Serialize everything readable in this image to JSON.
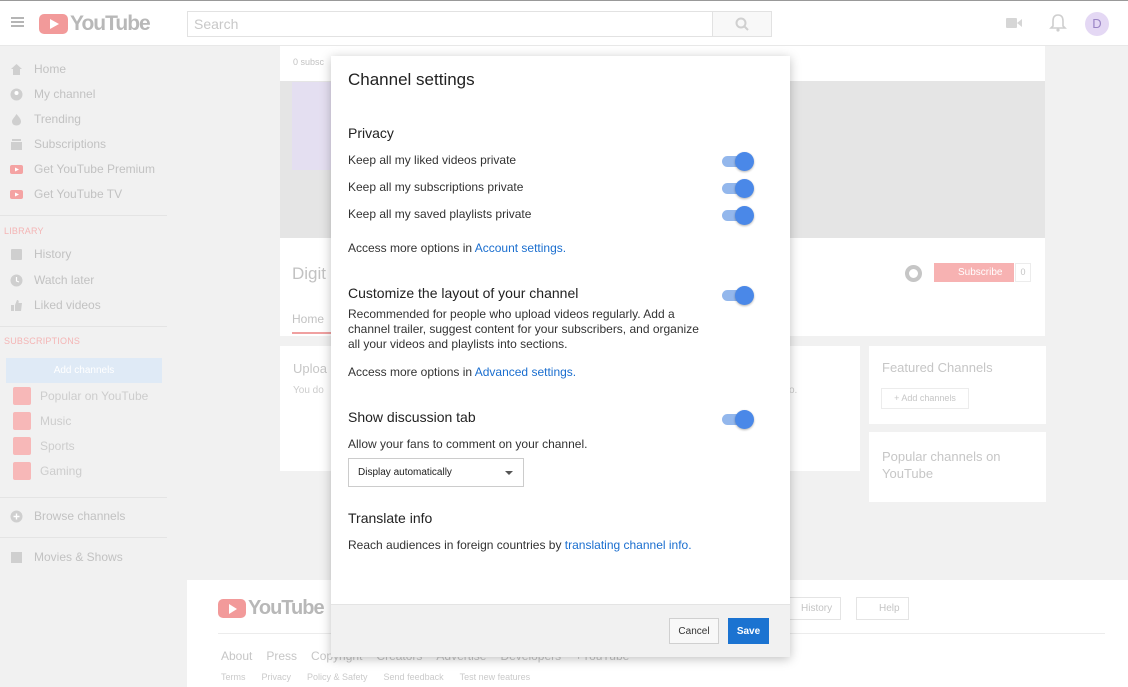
{
  "header": {
    "logo_text": "YouTube",
    "search_placeholder": "Search",
    "avatar_letter": "D"
  },
  "sidebar": {
    "items": [
      {
        "label": "Home",
        "icon": "home-icon"
      },
      {
        "label": "My channel",
        "icon": "person-icon"
      },
      {
        "label": "Trending",
        "icon": "flame-icon"
      },
      {
        "label": "Subscriptions",
        "icon": "subscriptions-icon"
      },
      {
        "label": "Get YouTube Premium",
        "icon": "youtube-icon"
      },
      {
        "label": "Get YouTube TV",
        "icon": "youtube-tv-icon"
      }
    ],
    "library_title": "LIBRARY",
    "library": [
      {
        "label": "History",
        "icon": "history-icon"
      },
      {
        "label": "Watch later",
        "icon": "clock-icon"
      },
      {
        "label": "Liked videos",
        "icon": "thumbs-up-icon"
      }
    ],
    "subscriptions_title": "SUBSCRIPTIONS",
    "add_channels": "Add channels",
    "subscriptions": [
      {
        "label": "Popular on YouTube"
      },
      {
        "label": "Music"
      },
      {
        "label": "Sports"
      },
      {
        "label": "Gaming"
      }
    ],
    "browse_channels": "Browse channels",
    "movies_shows": "Movies & Shows"
  },
  "channel": {
    "subscriber_strip": "0 subsc",
    "name": "Digit",
    "tab_home": "Home",
    "subscribe": "Subscribe",
    "subscriber_count": "0",
    "upload_title": "Uploa",
    "upload_text": "You do",
    "upload_tail": "o.",
    "featured_title": "Featured Channels",
    "featured_add": "+ Add channels",
    "popular_title": "Popular channels on YouTube"
  },
  "footer": {
    "logo_text": "YouTube",
    "history": "History",
    "help": "Help",
    "links_primary": [
      "About",
      "Press",
      "Copyright",
      "Creators",
      "Advertise",
      "Developers",
      "+YouTube"
    ],
    "links_secondary": [
      "Terms",
      "Privacy",
      "Policy & Safety",
      "Send feedback",
      "Test new features"
    ]
  },
  "modal": {
    "title": "Channel settings",
    "privacy": {
      "heading": "Privacy",
      "liked": "Keep all my liked videos private",
      "subscriptions": "Keep all my subscriptions private",
      "playlists": "Keep all my saved playlists private",
      "access_prefix": "Access more options in ",
      "access_link": "Account settings",
      "access_suffix": "."
    },
    "layout": {
      "heading": "Customize the layout of your channel",
      "description": "Recommended for people who upload videos regularly. Add a channel trailer, suggest content for your subscribers, and organize all your videos and playlists into sections.",
      "access_prefix": "Access more options in ",
      "access_link": "Advanced settings",
      "access_suffix": "."
    },
    "discussion": {
      "heading": "Show discussion tab",
      "description": "Allow your fans to comment on your channel.",
      "select_value": "Display automatically"
    },
    "translate": {
      "heading": "Translate info",
      "prefix": "Reach audiences in foreign countries by ",
      "link": "translating channel info",
      "suffix": "."
    },
    "toggles": {
      "liked_private": true,
      "subscriptions_private": true,
      "playlists_private": true,
      "customize_layout": true,
      "discussion_tab": true
    },
    "cancel": "Cancel",
    "save": "Save"
  },
  "colors": {
    "toggle_on": "#4a88e8",
    "link": "#1a6ecf",
    "save_button": "#1b73d1"
  }
}
